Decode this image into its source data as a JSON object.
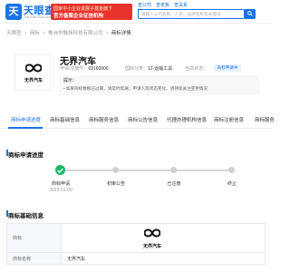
{
  "header": {
    "logo_mark": "天",
    "logo_text": "天眼查",
    "logo_sub": "TianYanCha.com",
    "promo_line1": "国家中小企业发展子基金旗下",
    "promo_line2": "官方备案企业征信机构",
    "nav_tabs": [
      "查公司",
      "查老板",
      "查关系"
    ],
    "search_placeholder": "请输入公司名称、人名、品牌名称等关键词"
  },
  "breadcrumb": {
    "items": [
      "天眼查",
      "商标",
      "株洲市魅族科技有限公司",
      "商标详情"
    ]
  },
  "trademark": {
    "name": "无界汽车",
    "logo_text": "无界汽车",
    "reg_no_label": "申请/注册号：",
    "reg_no": "69160906",
    "class_label": "国际分类：",
    "class_value": "12-运输工具",
    "status_label": "当前状态：",
    "status_value": "商标申请中",
    "status_badge": "商标申请中",
    "hint_title": "提示：",
    "hint_text": "• 如果商标数据已过期，请及时续展；申请人等状态变化、请持续关注变更情况"
  },
  "tabs": [
    "商标申请进度",
    "商标基础信息",
    "商标服务信息",
    "商标公告信息",
    "代理办理机构信息",
    "商标注册信息",
    "商标服务"
  ],
  "progress": {
    "section_title": "商标申请进度",
    "steps": [
      {
        "label": "商标申请",
        "date": "2023-01-09",
        "state": "done"
      },
      {
        "label": "初审公告",
        "date": "",
        "state": "pending"
      },
      {
        "label": "已注册",
        "date": "",
        "state": "pending"
      },
      {
        "label": "终止",
        "date": "",
        "state": "pending"
      }
    ]
  },
  "basic_info": {
    "section_title": "商标基础信息",
    "rows": [
      {
        "label": "商标",
        "value": ""
      },
      {
        "label": "商标名称",
        "value": "无界汽车"
      }
    ]
  },
  "colors": {
    "primary": "#1a73e8",
    "success": "#17b86b",
    "promo_red": "#e8332c"
  }
}
